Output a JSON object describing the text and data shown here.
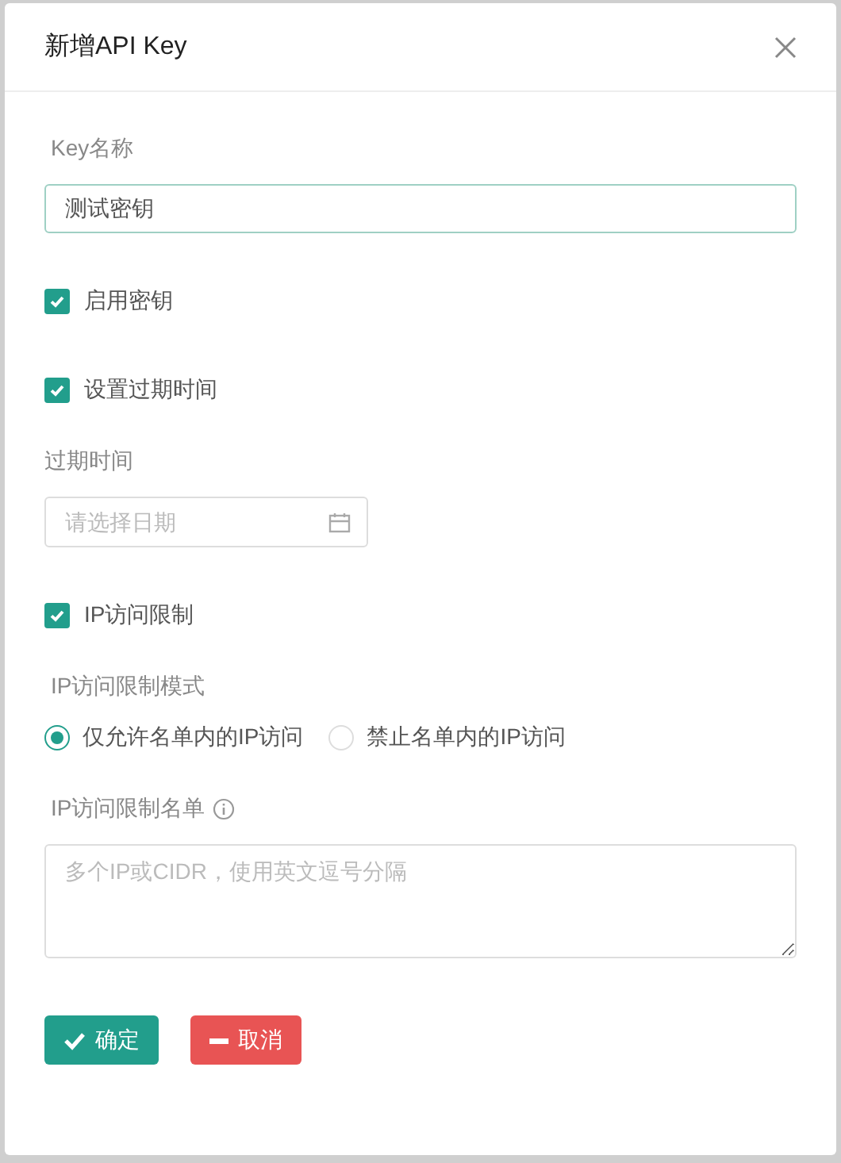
{
  "dialog": {
    "title": "新增API Key"
  },
  "fields": [
    {
      "kind": "text",
      "label": "Key名称",
      "value": "测试密钥"
    },
    {
      "kind": "checkbox",
      "label": "启用密钥",
      "checked": true
    },
    {
      "kind": "checkbox",
      "label": "设置过期时间",
      "checked": true
    },
    {
      "kind": "date",
      "label": "过期时间",
      "placeholder": "请选择日期"
    },
    {
      "kind": "checkbox",
      "label": "IP访问限制",
      "checked": true
    },
    {
      "kind": "radio",
      "label": "IP访问限制模式",
      "options": [
        {
          "label": "仅允许名单内的IP访问",
          "selected": true
        },
        {
          "label": "禁止名单内的IP访问",
          "selected": false
        }
      ]
    },
    {
      "kind": "textarea",
      "label": "IP访问限制名单",
      "info": true,
      "placeholder": "多个IP或CIDR，使用英文逗号分隔"
    }
  ],
  "buttons": [
    {
      "kind": "confirm",
      "label": "确定"
    },
    {
      "kind": "cancel",
      "label": "取消"
    }
  ]
}
